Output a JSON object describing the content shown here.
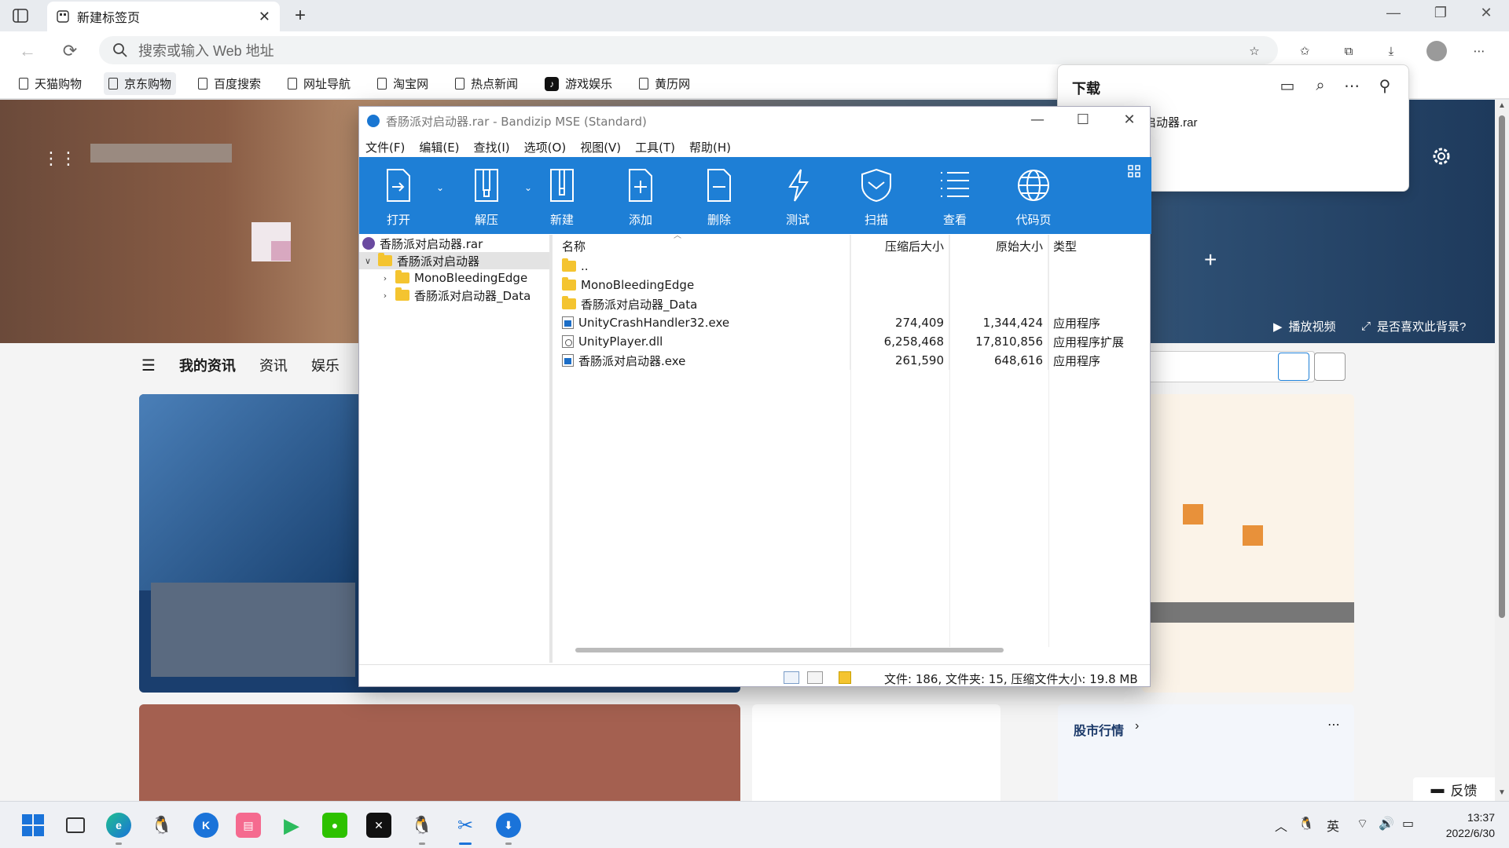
{
  "browser": {
    "tab_title": "新建标签页",
    "address_placeholder": "搜索或输入 Web 地址",
    "favorites": [
      {
        "label": "天猫购物"
      },
      {
        "label": "京东购物"
      },
      {
        "label": "百度搜索"
      },
      {
        "label": "网址导航"
      },
      {
        "label": "淘宝网"
      },
      {
        "label": "热点新闻"
      },
      {
        "label": "游戏娱乐"
      },
      {
        "label": "黄历网"
      }
    ]
  },
  "downloads": {
    "title": "下载",
    "file_partial": "启动器.rar"
  },
  "newtab": {
    "play_video": "播放视频",
    "like_background": "是否喜欢此背景?",
    "nav": [
      "我的资讯",
      "资讯",
      "娱乐"
    ],
    "stock_title": "股市行情",
    "feedback": "反馈"
  },
  "bandizip": {
    "title": "香肠派对启动器.rar - Bandizip MSE (Standard)",
    "menu": [
      "文件(F)",
      "编辑(E)",
      "查找(I)",
      "选项(O)",
      "视图(V)",
      "工具(T)",
      "帮助(H)"
    ],
    "toolbar": [
      {
        "label": "打开",
        "icon": "open-icon"
      },
      {
        "label": "解压",
        "icon": "extract-icon"
      },
      {
        "label": "新建",
        "icon": "new-archive-icon"
      },
      {
        "label": "添加",
        "icon": "add-file-icon"
      },
      {
        "label": "删除",
        "icon": "delete-file-icon"
      },
      {
        "label": "测试",
        "icon": "test-icon"
      },
      {
        "label": "扫描",
        "icon": "scan-shield-icon"
      },
      {
        "label": "查看",
        "icon": "view-list-icon"
      },
      {
        "label": "代码页",
        "icon": "codepage-globe-icon"
      }
    ],
    "tree": {
      "root": "香肠派对启动器.rar",
      "folder": "香肠派对启动器",
      "children": [
        "MonoBleedingEdge",
        "香肠派对启动器_Data"
      ]
    },
    "columns": {
      "name": "名称",
      "compressed": "压缩后大小",
      "original": "原始大小",
      "type": "类型"
    },
    "files": [
      {
        "name": "..",
        "kind": "folder",
        "compressed": "",
        "original": "",
        "type": ""
      },
      {
        "name": "MonoBleedingEdge",
        "kind": "folder",
        "compressed": "",
        "original": "",
        "type": ""
      },
      {
        "name": "香肠派对启动器_Data",
        "kind": "folder",
        "compressed": "",
        "original": "",
        "type": ""
      },
      {
        "name": "UnityCrashHandler32.exe",
        "kind": "exe",
        "compressed": "274,409",
        "original": "1,344,424",
        "type": "应用程序"
      },
      {
        "name": "UnityPlayer.dll",
        "kind": "dll",
        "compressed": "6,258,468",
        "original": "17,810,856",
        "type": "应用程序扩展"
      },
      {
        "name": "香肠派对启动器.exe",
        "kind": "exe",
        "compressed": "261,590",
        "original": "648,616",
        "type": "应用程序"
      }
    ],
    "status": "文件: 186, 文件夹: 15, 压缩文件大小: 19.8 MB"
  },
  "taskbar": {
    "ime": "英",
    "time": "13:37",
    "date": "2022/6/30"
  },
  "colors": {
    "bandizip_toolbar": "#1e7fd6",
    "folder": "#f4c430"
  }
}
